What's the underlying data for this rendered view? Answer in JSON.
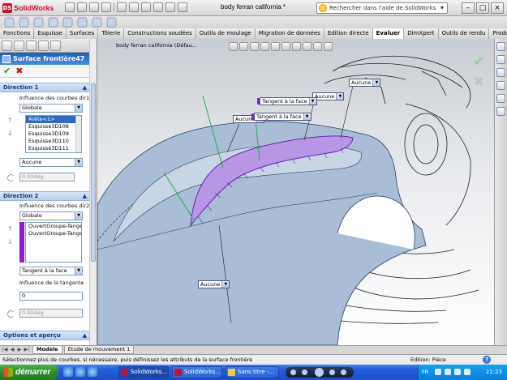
{
  "titlebar": {
    "app_name": "SolidWorks",
    "document_title": "body ferran california *",
    "help_search_placeholder": "Rechercher dans l'aide de SolidWorks"
  },
  "command_tabs": [
    {
      "label": "Fonctions"
    },
    {
      "label": "Esquisse"
    },
    {
      "label": "Surfaces"
    },
    {
      "label": "Tôlerie"
    },
    {
      "label": "Constructions soudées"
    },
    {
      "label": "Outils de moulage"
    },
    {
      "label": "Migration de données"
    },
    {
      "label": "Edition directe"
    },
    {
      "label": "Evaluer"
    },
    {
      "label": "DimXpert"
    },
    {
      "label": "Outils de rendu"
    },
    {
      "label": "Produ"
    }
  ],
  "property_manager": {
    "title": "Surface frontière47",
    "help": "?",
    "ok": "✔",
    "cancel": "✖",
    "direction1": {
      "heading": "Direction 1",
      "influence_label": "Influence des courbes dir1",
      "influence_value": "Globale",
      "curves": [
        "Arête<1>",
        "Esquisse3D108",
        "Esquisse3D109",
        "Esquisse3D110",
        "Esquisse3D111"
      ],
      "tangency_value": "Aucune",
      "angle_value": "0.00deg"
    },
    "direction2": {
      "heading": "Direction 2",
      "influence_label": "Influence des courbes dir2",
      "influence_value": "Globale",
      "curves": [
        "OuvertGroupe-Tangen",
        "OuvertGroupe-Tangen"
      ],
      "tangency_value": "Tangent à la face",
      "tangent_influence_label": "Influence de la tangente",
      "tangent_influence_value": "0",
      "angle_value": "0.00deg"
    },
    "options": {
      "heading": "Options et aperçu"
    }
  },
  "graphics": {
    "tree_label": "body ferran california  (Défau...",
    "callouts": [
      {
        "label": "Aucune"
      },
      {
        "label": "Aucune"
      },
      {
        "label": "Tangent à la face"
      },
      {
        "label": "Aucune"
      },
      {
        "label": "Tangent à la face"
      },
      {
        "label": "Aucune"
      }
    ]
  },
  "bottom_tabs": [
    {
      "label": "Modèle"
    },
    {
      "label": "Etude de mouvement 1"
    }
  ],
  "statusbar": {
    "message": "Sélectionnez plus de courbes, si nécessaire, puis définissez les attributs de la surface frontière",
    "mode": "Edition: Pièce",
    "help": "?"
  },
  "taskbar": {
    "start": "démarrer",
    "buttons": [
      {
        "label": "SolidWorks..."
      },
      {
        "label": "SolidWorks..."
      },
      {
        "label": "Sans titre -..."
      }
    ],
    "language": "FR",
    "clock": "21:23"
  },
  "colors": {
    "accent": "#8a1fd1",
    "header_blue": "#1f5fb8",
    "taskbar_blue": "#245edb",
    "start_green": "#2d8f2d"
  }
}
